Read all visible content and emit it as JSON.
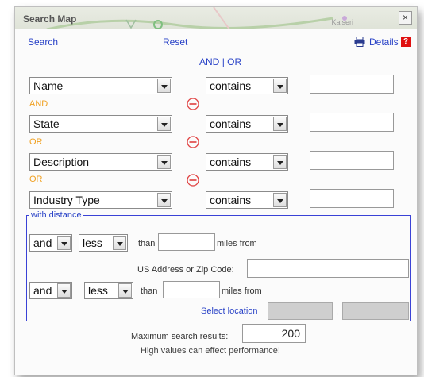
{
  "dialog": {
    "title": "Search Map",
    "map_label": "Kaiseri",
    "close_label": "×"
  },
  "toolbar": {
    "search_label": "Search",
    "reset_label": "Reset",
    "details_label": "Details",
    "help_label": "?"
  },
  "logic_toggle": {
    "and_label": "AND",
    "separator": "|",
    "or_label": "OR"
  },
  "criteria": [
    {
      "field": "Name",
      "operator": "contains",
      "value": ""
    },
    {
      "connector": "AND",
      "field": "State",
      "operator": "contains",
      "value": ""
    },
    {
      "connector": "OR",
      "field": "Description",
      "operator": "contains",
      "value": ""
    },
    {
      "connector": "OR",
      "field": "Industry Type",
      "operator": "contains",
      "value": ""
    }
  ],
  "distance": {
    "legend": "with distance",
    "row1": {
      "logic": "and",
      "comparison": "less",
      "than_label": "than",
      "value": "",
      "unit_label": "miles from"
    },
    "address_label": "US Address or Zip Code:",
    "address_value": "",
    "row2": {
      "logic": "and",
      "comparison": "less",
      "than_label": "than",
      "value": "",
      "unit_label": "miles from"
    },
    "select_location_label": "Select location",
    "coord_separator": ","
  },
  "results": {
    "max_label": "Maximum search results:",
    "max_value": "200",
    "warning": "High values can effect performance!"
  },
  "colors": {
    "link": "#2a43c7",
    "connector": "#f0a020",
    "remove": "#e04040",
    "help_bg": "#e01010"
  }
}
